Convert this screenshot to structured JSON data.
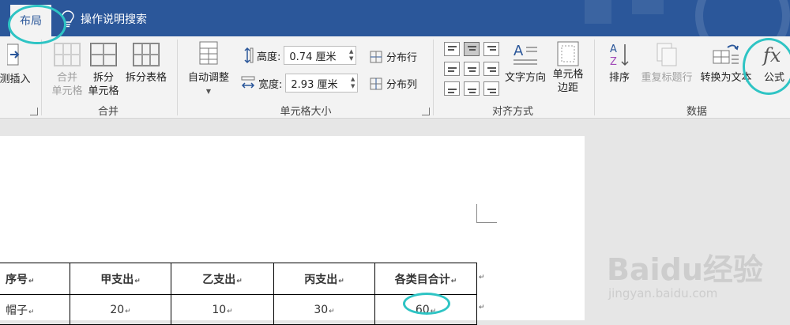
{
  "tabs": {
    "active_tab": "布局",
    "search_label": "操作说明搜索"
  },
  "ribbon": {
    "insert_partial": "测插入",
    "merge_group": {
      "merge_cells": "合并\n单元格",
      "split_cells": "拆分\n单元格",
      "split_table": "拆分表格",
      "label": "合并"
    },
    "cell_size_group": {
      "autofit": "自动调整",
      "height_label": "高度:",
      "height_value": "0.74 厘米",
      "width_label": "宽度:",
      "width_value": "2.93 厘米",
      "distribute_rows": "分布行",
      "distribute_cols": "分布列",
      "label": "单元格大小"
    },
    "alignment_group": {
      "text_direction": "文字方向",
      "cell_margins": "单元格\n边距",
      "label": "对齐方式"
    },
    "data_group": {
      "sort": "排序",
      "repeat_header": "重复标题行",
      "convert_to_text": "转换为文本",
      "formula": "公式",
      "label": "数据"
    }
  },
  "table": {
    "headers": [
      "序号",
      "甲支出",
      "乙支出",
      "丙支出",
      "各类目合计"
    ],
    "rows": [
      [
        "帽子",
        "20",
        "10",
        "30",
        "60"
      ]
    ]
  },
  "watermark": {
    "brand": "Baidu经验",
    "url": "jingyan.baidu.com"
  },
  "colors": {
    "title_blue": "#2b579a",
    "annotation": "#2ec4c4"
  }
}
